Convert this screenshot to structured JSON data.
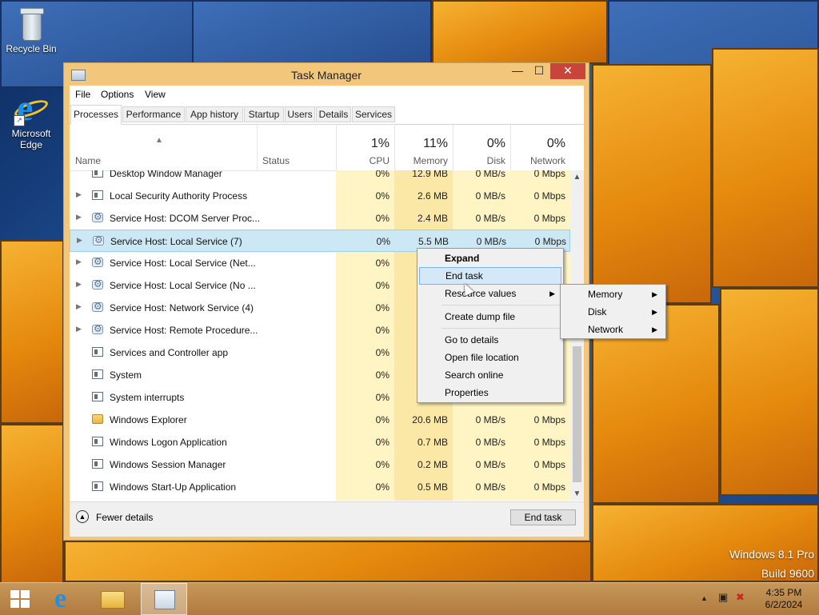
{
  "desktop": {
    "icons": [
      {
        "label": "Recycle Bin",
        "icon": "recycle-bin-icon"
      },
      {
        "label": "Microsoft Edge",
        "label_line1": "Microsoft",
        "label_line2": "Edge",
        "icon": "edge-icon"
      }
    ],
    "watermark": {
      "line1": "Windows 8.1 Pro",
      "line2": "Build 9600"
    }
  },
  "window": {
    "title": "Task Manager",
    "caption": {
      "minimize": "—",
      "maximize": "☐",
      "close": "✕"
    },
    "menu": [
      "File",
      "Options",
      "View"
    ],
    "tabs": [
      "Processes",
      "Performance",
      "App history",
      "Startup",
      "Users",
      "Details",
      "Services"
    ],
    "active_tab": "Processes",
    "columns": {
      "name": "Name",
      "status": "Status",
      "cpu": {
        "label": "CPU",
        "pct": "1%"
      },
      "memory": {
        "label": "Memory",
        "pct": "11%"
      },
      "disk": {
        "label": "Disk",
        "pct": "0%"
      },
      "network": {
        "label": "Network",
        "pct": "0%"
      }
    },
    "processes": [
      {
        "name": "Desktop Window Manager",
        "icon": "window",
        "expandable": false,
        "cpu": "0%",
        "memory": "12.9 MB",
        "disk": "0 MB/s",
        "network": "0 Mbps"
      },
      {
        "name": "Local Security Authority Process",
        "icon": "window",
        "expandable": true,
        "cpu": "0%",
        "memory": "2.6 MB",
        "disk": "0 MB/s",
        "network": "0 Mbps"
      },
      {
        "name": "Service Host: DCOM Server Proc...",
        "icon": "gear",
        "expandable": true,
        "cpu": "0%",
        "memory": "2.4 MB",
        "disk": "0 MB/s",
        "network": "0 Mbps"
      },
      {
        "name": "Service Host: Local Service (7)",
        "icon": "gear",
        "expandable": true,
        "cpu": "0%",
        "memory": "5.5 MB",
        "disk": "0 MB/s",
        "network": "0 Mbps",
        "selected": true
      },
      {
        "name": "Service Host: Local Service (Net...",
        "icon": "gear",
        "expandable": true,
        "cpu": "0%",
        "memory": "",
        "disk": "",
        "network": ""
      },
      {
        "name": "Service Host: Local Service (No ...",
        "icon": "gear",
        "expandable": true,
        "cpu": "0%",
        "memory": "",
        "disk": "",
        "network": ""
      },
      {
        "name": "Service Host: Network Service (4)",
        "icon": "gear",
        "expandable": true,
        "cpu": "0%",
        "memory": "",
        "disk": "",
        "network": ""
      },
      {
        "name": "Service Host: Remote Procedure...",
        "icon": "gear",
        "expandable": true,
        "cpu": "0%",
        "memory": "",
        "disk": "",
        "network": ""
      },
      {
        "name": "Services and Controller app",
        "icon": "window",
        "expandable": false,
        "cpu": "0%",
        "memory": "",
        "disk": "",
        "network": ""
      },
      {
        "name": "System",
        "icon": "window",
        "expandable": false,
        "cpu": "0%",
        "memory": "",
        "disk": "",
        "network": ""
      },
      {
        "name": "System interrupts",
        "icon": "window",
        "expandable": false,
        "cpu": "0%",
        "memory": "",
        "disk": "",
        "network": ""
      },
      {
        "name": "Windows Explorer",
        "icon": "folder",
        "expandable": false,
        "cpu": "0%",
        "memory": "20.6 MB",
        "disk": "0 MB/s",
        "network": "0 Mbps"
      },
      {
        "name": "Windows Logon Application",
        "icon": "window",
        "expandable": false,
        "cpu": "0%",
        "memory": "0.7 MB",
        "disk": "0 MB/s",
        "network": "0 Mbps"
      },
      {
        "name": "Windows Session Manager",
        "icon": "window",
        "expandable": false,
        "cpu": "0%",
        "memory": "0.2 MB",
        "disk": "0 MB/s",
        "network": "0 Mbps"
      },
      {
        "name": "Windows Start-Up Application",
        "icon": "window",
        "expandable": false,
        "cpu": "0%",
        "memory": "0.5 MB",
        "disk": "0 MB/s",
        "network": "0 Mbps"
      }
    ],
    "footer": {
      "fewer_details": "Fewer details",
      "end_task": "End task"
    }
  },
  "context_menu": {
    "items": [
      {
        "label": "Expand",
        "bold": true
      },
      {
        "label": "End task",
        "highlighted": true
      },
      {
        "label": "Resource values",
        "submenu": true
      },
      {
        "label": "Create dump file"
      },
      {
        "label": "Go to details"
      },
      {
        "label": "Open file location"
      },
      {
        "label": "Search online"
      },
      {
        "label": "Properties"
      }
    ],
    "submenu": [
      "Memory",
      "Disk",
      "Network"
    ]
  },
  "taskbar": {
    "items": [
      {
        "name": "start",
        "icon": "windows-logo-icon"
      },
      {
        "name": "internet-explorer",
        "icon": "ie-icon"
      },
      {
        "name": "file-explorer",
        "icon": "folder-icon"
      },
      {
        "name": "task-manager",
        "icon": "task-manager-icon",
        "active": true
      }
    ],
    "clock": {
      "time": "4:35 PM",
      "date": "6/2/2024"
    }
  },
  "colors": {
    "accent_selected": "#cce8f4",
    "close_button": "#c7453b",
    "heat_memory": "#fbe8a6",
    "heat_low": "#fff4c4"
  }
}
